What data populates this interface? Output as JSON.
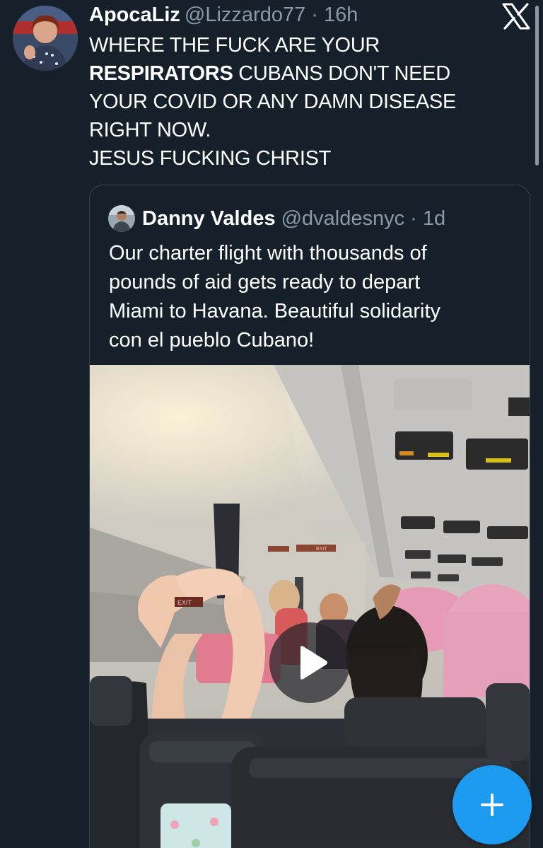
{
  "tweet": {
    "author_name": "ApocaLiz",
    "meta": "@Lizzardo77 · 16h",
    "text_lines": [
      {
        "bold": "",
        "rest": "WHERE THE FUCK ARE YOUR"
      },
      {
        "bold": "RESPIRATORS",
        "rest": " CUBANS DON'T NEED"
      },
      {
        "bold": "",
        "rest": "YOUR COVID OR ANY DAMN DISEASE"
      },
      {
        "bold": "",
        "rest": "RIGHT NOW."
      },
      {
        "bold": "",
        "rest": "JESUS FUCKING CHRIST"
      }
    ]
  },
  "quoted_tweet": {
    "author_name": "Danny Valdes",
    "meta": "@dvaldesnyc · 1d",
    "text_lines": [
      "Our charter flight with thousands of",
      "pounds of aid gets ready to depart",
      "Miami to Havana. Beautiful solidarity",
      "con el pueblo Cubano!"
    ],
    "media": {
      "type": "video",
      "signs": {
        "exit_left": "EXIT",
        "exit_far": "EXIT"
      }
    }
  },
  "icons": {
    "close": "x-logo-icon",
    "play": "play-icon",
    "compose": "plus-icon"
  },
  "colors": {
    "background": "#15202b",
    "accent": "#1d9bf0",
    "secondary_text": "#8b98a5",
    "border": "#38444d"
  }
}
